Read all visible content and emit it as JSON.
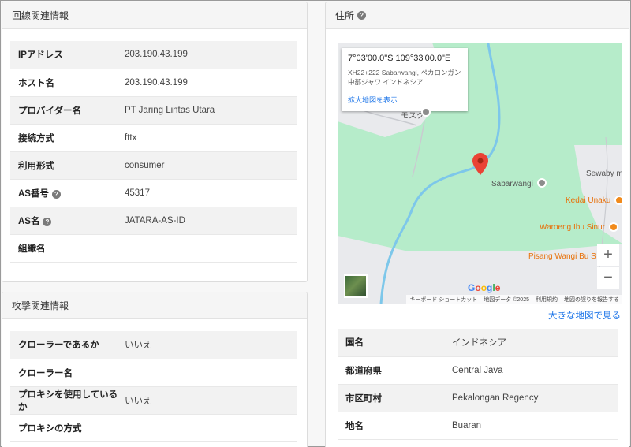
{
  "line_info": {
    "title": "回線関連情報",
    "rows": [
      {
        "label": "IPアドレス",
        "value": "203.190.43.199",
        "help": false
      },
      {
        "label": "ホスト名",
        "value": "203.190.43.199",
        "help": false
      },
      {
        "label": "プロバイダー名",
        "value": "PT Jaring Lintas Utara",
        "help": false
      },
      {
        "label": "接続方式",
        "value": "fttx",
        "help": false
      },
      {
        "label": "利用形式",
        "value": "consumer",
        "help": false
      },
      {
        "label": "AS番号",
        "value": "45317",
        "help": true
      },
      {
        "label": "AS名",
        "value": "JATARA-AS-ID",
        "help": true
      },
      {
        "label": "組織名",
        "value": "",
        "help": false
      }
    ]
  },
  "attack_info": {
    "title": "攻撃関連情報",
    "rows": [
      {
        "label": "クローラーであるか",
        "value": "いいえ"
      },
      {
        "label": "クローラー名",
        "value": ""
      },
      {
        "label": "プロキシを使用しているか",
        "value": "いいえ"
      },
      {
        "label": "プロキシの方式",
        "value": ""
      }
    ]
  },
  "address": {
    "title": "住所",
    "map": {
      "coords": "7°03'00.0\"S 109°33'00.0\"E",
      "addr_line1": "XH22+222 Sabarwangi, ペカロンガン",
      "addr_line2": "中部ジャワ インドネシア",
      "expand_link": "拡大地図を表示",
      "labels": {
        "mosque": "モスク",
        "sabarwangi": "Sabarwangi",
        "sewaby": "Sewaby m",
        "kedai": "Kedai Unaku",
        "waroeng": "Waroeng Ibu Sinur",
        "pisang": "Pisang Wangi Bu S"
      },
      "zoom_in": "+",
      "zoom_out": "−",
      "google": [
        "G",
        "o",
        "o",
        "g",
        "l",
        "e"
      ],
      "attribution": [
        "キーボード ショートカット",
        "地図データ ©2025",
        "利用規約",
        "地図の誤りを報告する"
      ],
      "colors": {
        "land": "#b6ecca",
        "built": "#e9eaed",
        "river": "#7dc7ea",
        "pin": "#ea4335"
      }
    },
    "big_map_link": "大きな地図で見る",
    "rows": [
      {
        "label": "国名",
        "value": "インドネシア"
      },
      {
        "label": "都道府県",
        "value": "Central Java"
      },
      {
        "label": "市区町村",
        "value": "Pekalongan Regency"
      },
      {
        "label": "地名",
        "value": "Buaran"
      }
    ]
  }
}
